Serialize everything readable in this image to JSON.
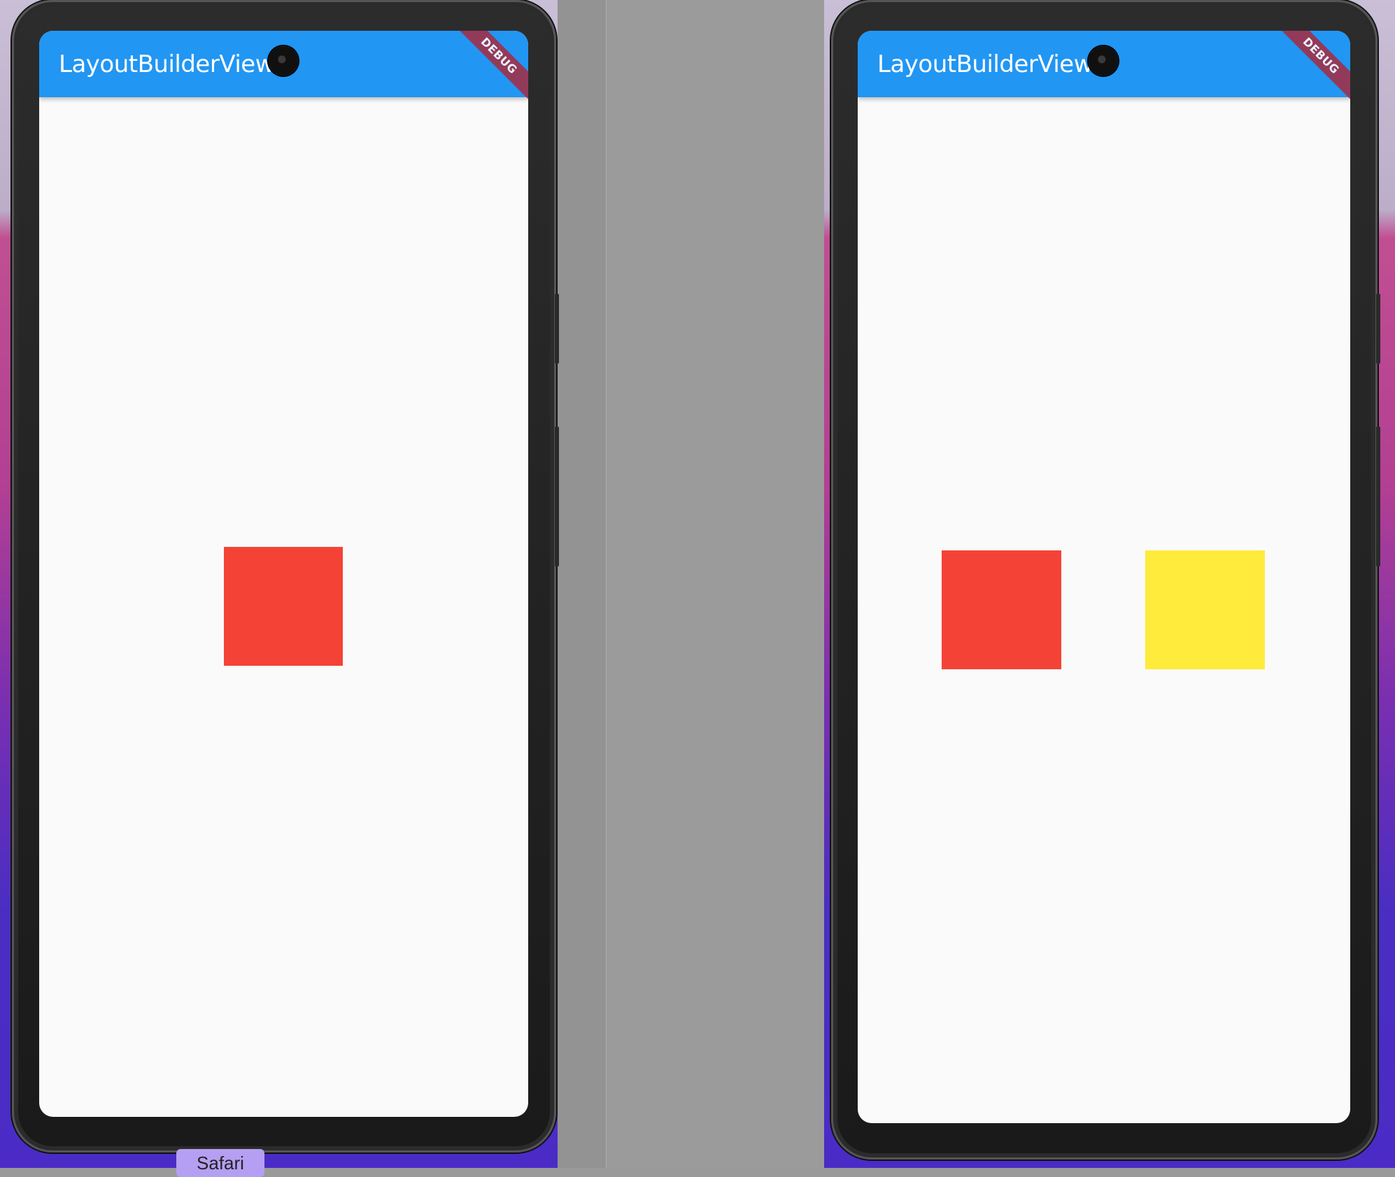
{
  "phones": [
    {
      "app_bar_title": "LayoutBuilderView",
      "debug_banner": "DEBUG",
      "boxes": [
        {
          "color": "#f44336",
          "name": "red-box"
        }
      ]
    },
    {
      "app_bar_title": "LayoutBuilderView",
      "debug_banner": "DEBUG",
      "boxes": [
        {
          "color": "#f44336",
          "name": "red-box"
        },
        {
          "color": "#ffeb3b",
          "name": "yellow-box"
        }
      ]
    }
  ],
  "colors": {
    "app_bar": "#2196f3",
    "screen_background": "#fafafa",
    "red": "#f44336",
    "yellow": "#ffeb3b"
  },
  "dock": {
    "tooltip_label": "Safari"
  }
}
